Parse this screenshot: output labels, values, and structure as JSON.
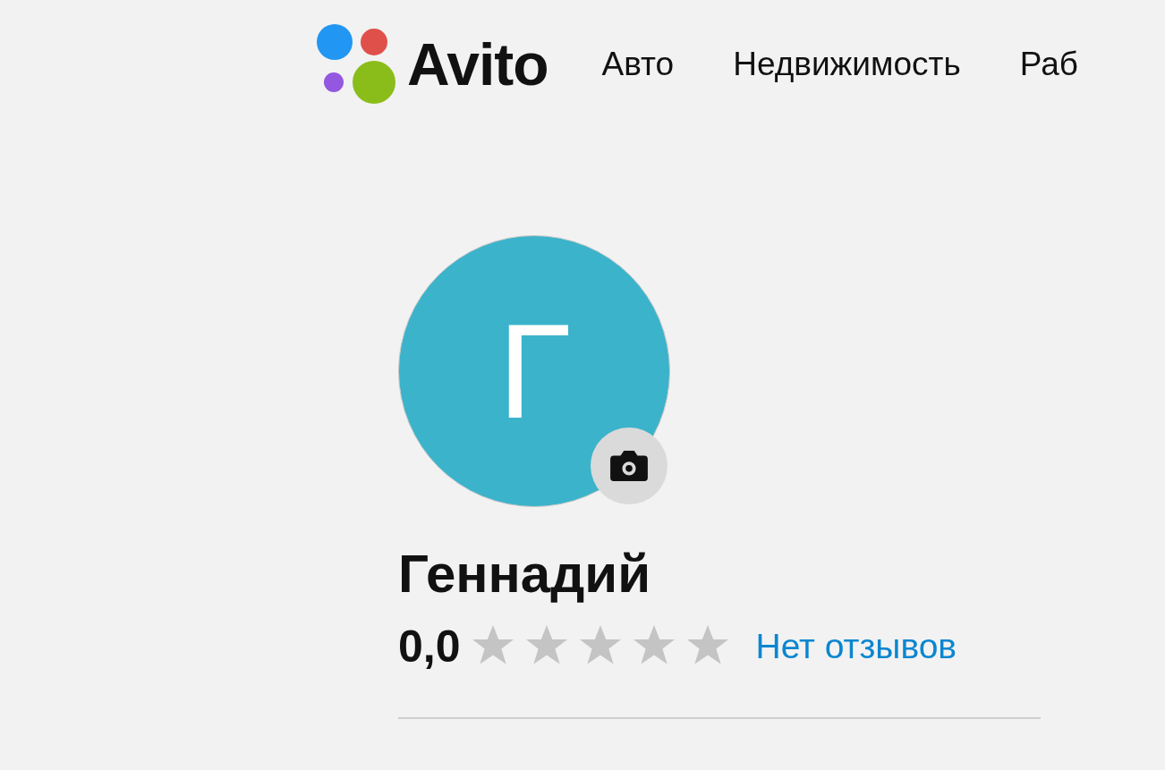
{
  "header": {
    "logo_text": "Avito",
    "nav": [
      {
        "label": "Авто"
      },
      {
        "label": "Недвижимость"
      },
      {
        "label": "Раб"
      }
    ]
  },
  "profile": {
    "avatar_letter": "Г",
    "name": "Геннадий",
    "rating": "0,0",
    "stars": 0,
    "reviews_link": "Нет отзывов"
  }
}
